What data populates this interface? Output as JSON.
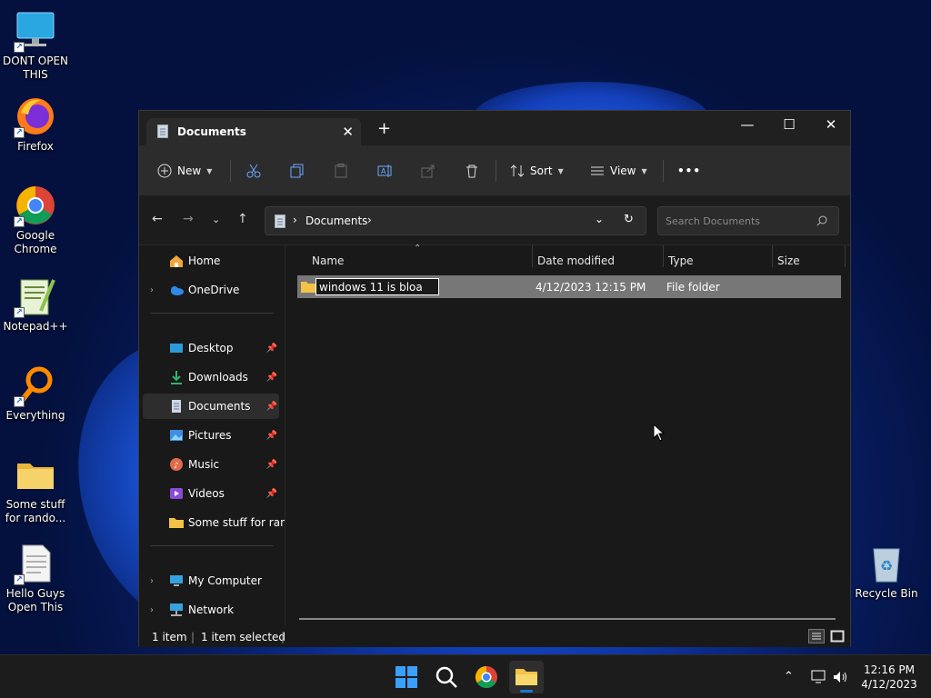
{
  "desktop": {
    "icons": [
      {
        "label_line1": "DONT OPEN",
        "label_line2": "THIS"
      },
      {
        "label_line1": "Firefox",
        "label_line2": ""
      },
      {
        "label_line1": "Google",
        "label_line2": "Chrome"
      },
      {
        "label_line1": "Notepad++",
        "label_line2": ""
      },
      {
        "label_line1": "Everything",
        "label_line2": ""
      },
      {
        "label_line1": "Some stuff",
        "label_line2": "for rando..."
      },
      {
        "label_line1": "Hello Guys",
        "label_line2": "Open This"
      },
      {
        "label_line1": "Recycle Bin",
        "label_line2": ""
      }
    ]
  },
  "window": {
    "tab_title": "Documents",
    "toolbar": {
      "new_label": "New",
      "sort_label": "Sort",
      "view_label": "View",
      "more_label": "•••"
    },
    "address": {
      "crumb": "Documents"
    },
    "search": {
      "placeholder": "Search Documents"
    },
    "sidebar": {
      "items": [
        {
          "label": "Home"
        },
        {
          "label": "OneDrive"
        },
        {
          "label": "Desktop"
        },
        {
          "label": "Downloads"
        },
        {
          "label": "Documents"
        },
        {
          "label": "Pictures"
        },
        {
          "label": "Music"
        },
        {
          "label": "Videos"
        },
        {
          "label": "Some stuff for rand"
        },
        {
          "label": "My Computer"
        },
        {
          "label": "Network"
        }
      ]
    },
    "columns": {
      "name": "Name",
      "date": "Date modified",
      "type": "Type",
      "size": "Size"
    },
    "rows": [
      {
        "name": "windows 11 is bloa",
        "date": "4/12/2023 12:15 PM",
        "type": "File folder",
        "size": ""
      }
    ],
    "status": {
      "count": "1 item",
      "selected": "1 item selected"
    }
  },
  "taskbar": {
    "time": "12:16 PM",
    "date": "4/12/2023"
  },
  "colors": {
    "accent": "#1a78d6",
    "folder": "#f3c247",
    "window_bg": "#191919",
    "selected_row": "#777777"
  }
}
